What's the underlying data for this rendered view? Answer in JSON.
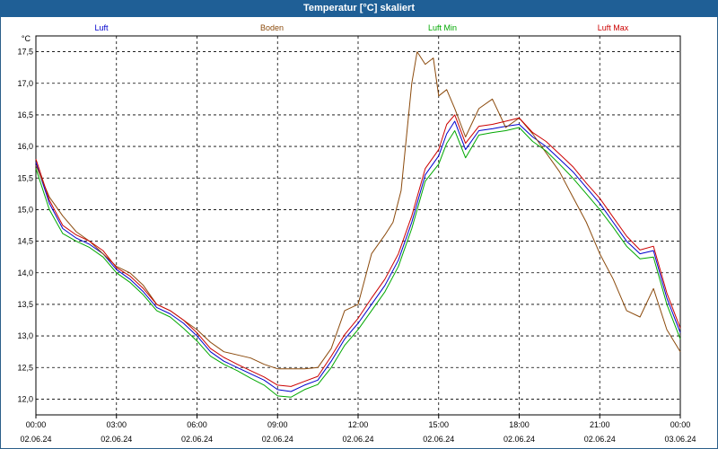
{
  "window": {
    "title": "Temperatur [°C] skaliert"
  },
  "chart_data": {
    "type": "line",
    "title": "Temperatur [°C] skaliert",
    "ylabel": "°C",
    "xlabel": "",
    "ylim": [
      11.75,
      17.75
    ],
    "y_ticks": [
      "12,0",
      "12,5",
      "13,0",
      "13,5",
      "14,0",
      "14,5",
      "15,0",
      "15,5",
      "16,0",
      "16,5",
      "17,0",
      "17,5"
    ],
    "y_tick_values": [
      12.0,
      12.5,
      13.0,
      13.5,
      14.0,
      14.5,
      15.0,
      15.5,
      16.0,
      16.5,
      17.0,
      17.5
    ],
    "x_tick_times": [
      "00:00",
      "03:00",
      "06:00",
      "09:00",
      "12:00",
      "15:00",
      "18:00",
      "21:00",
      "00:00"
    ],
    "x_tick_dates": [
      "02.06.24",
      "02.06.24",
      "02.06.24",
      "02.06.24",
      "02.06.24",
      "02.06.24",
      "02.06.24",
      "02.06.24",
      "03.06.24"
    ],
    "x_tick_hours": [
      0,
      3,
      6,
      9,
      12,
      15,
      18,
      21,
      24
    ],
    "xlim_hours": [
      0,
      24
    ],
    "grid": true,
    "legend": "top",
    "series": [
      {
        "name": "Luft",
        "color": "#0000cc",
        "x": [
          0,
          0.5,
          1,
          1.5,
          2,
          2.5,
          3,
          3.5,
          4,
          4.5,
          5,
          5.5,
          6,
          6.5,
          7,
          7.5,
          8,
          8.5,
          9,
          9.5,
          10,
          10.5,
          11,
          11.5,
          12,
          12.5,
          13,
          13.5,
          14,
          14.5,
          15,
          15.3,
          15.6,
          16,
          16.5,
          17,
          17.5,
          18,
          18.5,
          19,
          19.5,
          20,
          20.5,
          21,
          21.5,
          22,
          22.5,
          23,
          23.5,
          24
        ],
        "y": [
          15.75,
          15.1,
          14.7,
          14.55,
          14.45,
          14.3,
          14.05,
          13.9,
          13.7,
          13.45,
          13.35,
          13.2,
          13.0,
          12.75,
          12.6,
          12.5,
          12.4,
          12.3,
          12.15,
          12.12,
          12.22,
          12.3,
          12.6,
          12.95,
          13.2,
          13.5,
          13.8,
          14.2,
          14.8,
          15.55,
          15.85,
          16.2,
          16.4,
          15.95,
          16.25,
          16.28,
          16.32,
          16.35,
          16.15,
          16.0,
          15.8,
          15.6,
          15.35,
          15.1,
          14.8,
          14.5,
          14.3,
          14.35,
          13.6,
          13.05
        ]
      },
      {
        "name": "Boden",
        "color": "#8b4a0c",
        "x": [
          0,
          0.5,
          1,
          1.5,
          2,
          2.5,
          3,
          3.5,
          4,
          4.5,
          5,
          5.5,
          6,
          6.5,
          7,
          7.5,
          8,
          8.5,
          9,
          9.5,
          10,
          10.5,
          11,
          11.5,
          12,
          12.5,
          13,
          13.3,
          13.6,
          14,
          14.2,
          14.5,
          14.8,
          15,
          15.3,
          15.6,
          16,
          16.5,
          17,
          17.5,
          18,
          18.5,
          19,
          19.5,
          20,
          20.5,
          21,
          21.5,
          22,
          22.5,
          23,
          23.5,
          24
        ],
        "y": [
          15.7,
          15.2,
          14.9,
          14.65,
          14.5,
          14.3,
          14.1,
          14.0,
          13.8,
          13.5,
          13.4,
          13.25,
          13.1,
          12.9,
          12.75,
          12.7,
          12.65,
          12.55,
          12.48,
          12.48,
          12.48,
          12.5,
          12.8,
          13.4,
          13.5,
          14.3,
          14.6,
          14.8,
          15.3,
          17.0,
          17.5,
          17.3,
          17.4,
          16.8,
          16.9,
          16.6,
          16.15,
          16.6,
          16.75,
          16.3,
          16.45,
          16.2,
          15.9,
          15.6,
          15.2,
          14.8,
          14.3,
          13.9,
          13.4,
          13.3,
          13.75,
          13.1,
          12.75
        ]
      },
      {
        "name": "Luft Min",
        "color": "#00a800",
        "x": [
          0,
          0.5,
          1,
          1.5,
          2,
          2.5,
          3,
          3.5,
          4,
          4.5,
          5,
          5.5,
          6,
          6.5,
          7,
          7.5,
          8,
          8.5,
          9,
          9.5,
          10,
          10.5,
          11,
          11.5,
          12,
          12.5,
          13,
          13.5,
          14,
          14.5,
          15,
          15.3,
          15.6,
          16,
          16.5,
          17,
          17.5,
          18,
          18.5,
          19,
          19.5,
          20,
          20.5,
          21,
          21.5,
          22,
          22.5,
          23,
          23.5,
          24
        ],
        "y": [
          15.65,
          15.0,
          14.62,
          14.5,
          14.4,
          14.25,
          14.0,
          13.85,
          13.65,
          13.4,
          13.3,
          13.12,
          12.92,
          12.68,
          12.55,
          12.45,
          12.33,
          12.22,
          12.05,
          12.03,
          12.15,
          12.23,
          12.5,
          12.85,
          13.1,
          13.4,
          13.7,
          14.1,
          14.7,
          15.45,
          15.72,
          16.05,
          16.25,
          15.82,
          16.18,
          16.22,
          16.25,
          16.3,
          16.08,
          15.93,
          15.72,
          15.5,
          15.25,
          15.0,
          14.72,
          14.42,
          14.22,
          14.25,
          13.5,
          12.95
        ]
      },
      {
        "name": "Luft Max",
        "color": "#cc0000",
        "x": [
          0,
          0.5,
          1,
          1.5,
          2,
          2.5,
          3,
          3.5,
          4,
          4.5,
          5,
          5.5,
          6,
          6.5,
          7,
          7.5,
          8,
          8.5,
          9,
          9.5,
          10,
          10.5,
          11,
          11.5,
          12,
          12.5,
          13,
          13.5,
          14,
          14.5,
          15,
          15.3,
          15.6,
          16,
          16.5,
          17,
          17.5,
          18,
          18.5,
          19,
          19.5,
          20,
          20.5,
          21,
          21.5,
          22,
          22.5,
          23,
          23.5,
          24
        ],
        "y": [
          15.8,
          15.15,
          14.75,
          14.6,
          14.5,
          14.35,
          14.08,
          13.95,
          13.75,
          13.5,
          13.4,
          13.25,
          13.05,
          12.8,
          12.66,
          12.55,
          12.45,
          12.35,
          12.22,
          12.2,
          12.28,
          12.36,
          12.68,
          13.02,
          13.28,
          13.6,
          13.9,
          14.3,
          14.9,
          15.65,
          15.95,
          16.35,
          16.5,
          16.05,
          16.32,
          16.35,
          16.4,
          16.45,
          16.22,
          16.08,
          15.88,
          15.68,
          15.42,
          15.18,
          14.88,
          14.58,
          14.36,
          14.42,
          13.68,
          13.12
        ]
      }
    ]
  }
}
